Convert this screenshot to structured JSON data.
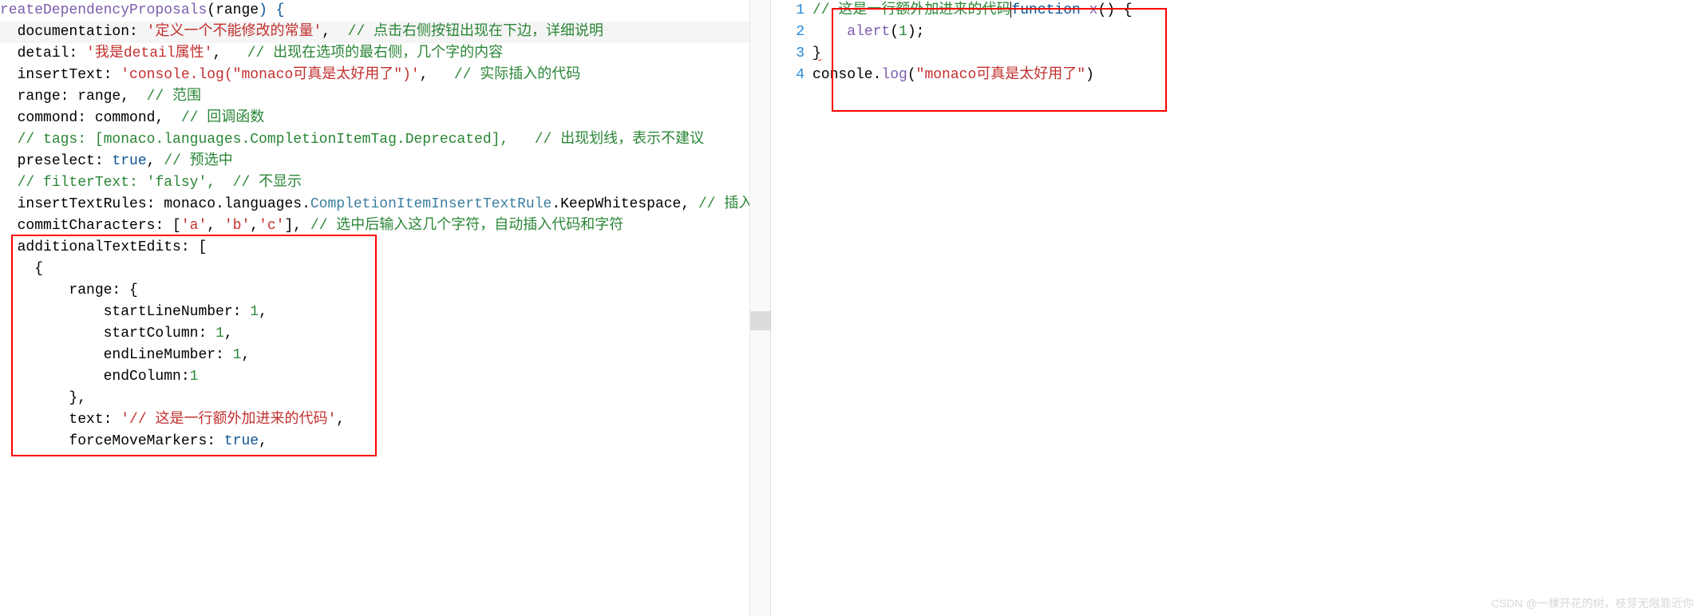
{
  "left": {
    "lines": [
      {
        "t": "l0",
        "indent": 0,
        "segments": [
          {
            "text": "reateDependencyProposals",
            "cls": "k-fn"
          },
          {
            "text": "(",
            "cls": "k-punct"
          },
          {
            "text": "range",
            "cls": "k-var"
          },
          {
            "text": ") {",
            "cls": "k-blue"
          }
        ]
      },
      {
        "t": "l1",
        "indent": 2,
        "hl": true,
        "segments": [
          {
            "text": "documentation: ",
            "cls": "k-key"
          },
          {
            "text": "'定义一个不能修改的常量'",
            "cls": "k-str"
          },
          {
            "text": ",  ",
            "cls": "k-punct"
          },
          {
            "text": "// 点击右侧按钮出现在下边，详细说明",
            "cls": "k-cmt"
          }
        ]
      },
      {
        "t": "l2",
        "indent": 2,
        "segments": [
          {
            "text": "detail: ",
            "cls": "k-key"
          },
          {
            "text": "'我是detail属性'",
            "cls": "k-str"
          },
          {
            "text": ",   ",
            "cls": "k-punct"
          },
          {
            "text": "// 出现在选项的最右侧，几个字的内容",
            "cls": "k-cmt"
          }
        ]
      },
      {
        "t": "l3",
        "indent": 2,
        "segments": [
          {
            "text": "insertText: ",
            "cls": "k-key"
          },
          {
            "text": "'console.log(\"monaco可真是太好用了\")'",
            "cls": "k-str"
          },
          {
            "text": ",   ",
            "cls": "k-punct"
          },
          {
            "text": "// 实际插入的代码",
            "cls": "k-cmt"
          }
        ]
      },
      {
        "t": "l4",
        "indent": 2,
        "segments": [
          {
            "text": "range: range,  ",
            "cls": "k-key"
          },
          {
            "text": "// 范围",
            "cls": "k-cmt"
          }
        ]
      },
      {
        "t": "l5",
        "indent": 2,
        "segments": [
          {
            "text": "commond: commond,  ",
            "cls": "k-key"
          },
          {
            "text": "// 回调函数",
            "cls": "k-cmt"
          }
        ]
      },
      {
        "t": "l6",
        "indent": 2,
        "segments": [
          {
            "text": "// tags: [monaco.languages.CompletionItemTag.Deprecated],   // 出现划线，表示不建议",
            "cls": "k-cmt"
          }
        ]
      },
      {
        "t": "l7",
        "indent": 2,
        "segments": [
          {
            "text": "preselect: ",
            "cls": "k-key"
          },
          {
            "text": "true",
            "cls": "k-bool"
          },
          {
            "text": ", ",
            "cls": "k-punct"
          },
          {
            "text": "// 预选中",
            "cls": "k-cmt"
          }
        ]
      },
      {
        "t": "l8",
        "indent": 2,
        "segments": [
          {
            "text": "// filterText: 'falsy',  // 不显示",
            "cls": "k-cmt"
          }
        ]
      },
      {
        "t": "l9",
        "indent": 2,
        "segments": [
          {
            "text": "insertTextRules: monaco.languages.",
            "cls": "k-key"
          },
          {
            "text": "CompletionItemInsertTextRule",
            "cls": "k-type"
          },
          {
            "text": ".KeepWhitespace, ",
            "cls": "k-key"
          },
          {
            "text": "// 插入的",
            "cls": "k-cmt"
          }
        ]
      },
      {
        "t": "l10",
        "indent": 2,
        "segments": [
          {
            "text": "commitCharacters: [",
            "cls": "k-key"
          },
          {
            "text": "'a'",
            "cls": "k-str"
          },
          {
            "text": ", ",
            "cls": "k-punct"
          },
          {
            "text": "'b'",
            "cls": "k-str"
          },
          {
            "text": ",",
            "cls": "k-punct"
          },
          {
            "text": "'c'",
            "cls": "k-str"
          },
          {
            "text": "], ",
            "cls": "k-punct"
          },
          {
            "text": "// 选中后输入这几个字符，自动插入代码和字符",
            "cls": "k-cmt"
          }
        ]
      },
      {
        "t": "l11",
        "indent": 2,
        "segments": [
          {
            "text": "additionalTextEdits: [",
            "cls": "k-key"
          }
        ]
      },
      {
        "t": "l12",
        "indent": 4,
        "segments": [
          {
            "text": "{",
            "cls": "k-punct"
          }
        ]
      },
      {
        "t": "l13",
        "indent": 8,
        "segments": [
          {
            "text": "range: {",
            "cls": "k-key"
          }
        ]
      },
      {
        "t": "l14",
        "indent": 12,
        "segments": [
          {
            "text": "startLineNumber: ",
            "cls": "k-key"
          },
          {
            "text": "1",
            "cls": "k-num"
          },
          {
            "text": ",",
            "cls": "k-punct"
          }
        ]
      },
      {
        "t": "l15",
        "indent": 12,
        "segments": [
          {
            "text": "startColumn: ",
            "cls": "k-key"
          },
          {
            "text": "1",
            "cls": "k-num"
          },
          {
            "text": ",",
            "cls": "k-punct"
          }
        ]
      },
      {
        "t": "l16",
        "indent": 12,
        "segments": [
          {
            "text": "endLineMumber: ",
            "cls": "k-key"
          },
          {
            "text": "1",
            "cls": "k-num"
          },
          {
            "text": ",",
            "cls": "k-punct"
          }
        ]
      },
      {
        "t": "l17",
        "indent": 12,
        "segments": [
          {
            "text": "endColumn:",
            "cls": "k-key"
          },
          {
            "text": "1",
            "cls": "k-num"
          }
        ]
      },
      {
        "t": "l18",
        "indent": 8,
        "segments": [
          {
            "text": "},",
            "cls": "k-punct"
          }
        ]
      },
      {
        "t": "l19",
        "indent": 8,
        "segments": [
          {
            "text": "text: ",
            "cls": "k-key"
          },
          {
            "text": "'// 这是一行额外加进来的代码'",
            "cls": "k-str"
          },
          {
            "text": ",",
            "cls": "k-punct"
          }
        ]
      },
      {
        "t": "l20",
        "indent": 8,
        "segments": [
          {
            "text": "forceMoveMarkers: ",
            "cls": "k-key"
          },
          {
            "text": "true",
            "cls": "k-bool"
          },
          {
            "text": ",",
            "cls": "k-punct"
          }
        ]
      }
    ]
  },
  "right": {
    "line_numbers": [
      "1",
      "2",
      "3",
      "4"
    ],
    "lines": [
      {
        "t": "r1",
        "segments": [
          {
            "text": "// 这是一行额外加进来的代码",
            "cls": "k-cmt"
          },
          {
            "text": "function",
            "cls": "k-blue"
          },
          {
            "text": " ",
            "cls": "k-punct"
          },
          {
            "text": "x",
            "cls": "k-fn"
          },
          {
            "text": "() {",
            "cls": "k-punct"
          }
        ]
      },
      {
        "t": "r2",
        "indent": 4,
        "segments": [
          {
            "text": "alert",
            "cls": "k-call"
          },
          {
            "text": "(",
            "cls": "k-punct"
          },
          {
            "text": "1",
            "cls": "k-num"
          },
          {
            "text": ");",
            "cls": "k-punct"
          }
        ]
      },
      {
        "t": "r3",
        "segments": [
          {
            "text": "}",
            "cls": "k-punct",
            "sq": true
          }
        ]
      },
      {
        "t": "r4",
        "segments": [
          {
            "text": "console.",
            "cls": "k-key"
          },
          {
            "text": "log",
            "cls": "k-call"
          },
          {
            "text": "(",
            "cls": "k-punct"
          },
          {
            "text": "\"monaco可真是太好用了\"",
            "cls": "k-str"
          },
          {
            "text": ")",
            "cls": "k-punct"
          }
        ]
      }
    ]
  },
  "watermark": "CSDN @一棵开花的树，枝芽无限靠近你"
}
